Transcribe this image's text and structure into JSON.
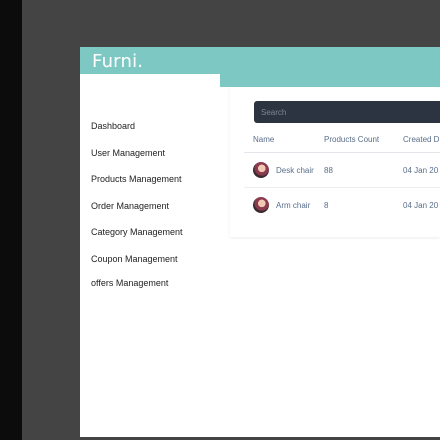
{
  "brand": {
    "logo": "Furni."
  },
  "sidebar": {
    "items": [
      {
        "label": "Dashboard"
      },
      {
        "label": "User Management"
      },
      {
        "label": "Products Management"
      },
      {
        "label": "Order Management"
      },
      {
        "label": "Category Management"
      },
      {
        "label": "Coupon Management"
      },
      {
        "label": "offers Management"
      }
    ]
  },
  "search": {
    "placeholder": "Search"
  },
  "table": {
    "headers": [
      "Name",
      "Products Count",
      "Created D"
    ],
    "rows": [
      {
        "name": "Desk chair",
        "count": "88",
        "created": "04 Jan 20"
      },
      {
        "name": "Arm chair",
        "count": "8",
        "created": "04 Jan 20"
      }
    ]
  },
  "colors": {
    "brand": "#7ec8c3",
    "search_bg": "#2c3442",
    "header_text": "#5a6d8a"
  }
}
